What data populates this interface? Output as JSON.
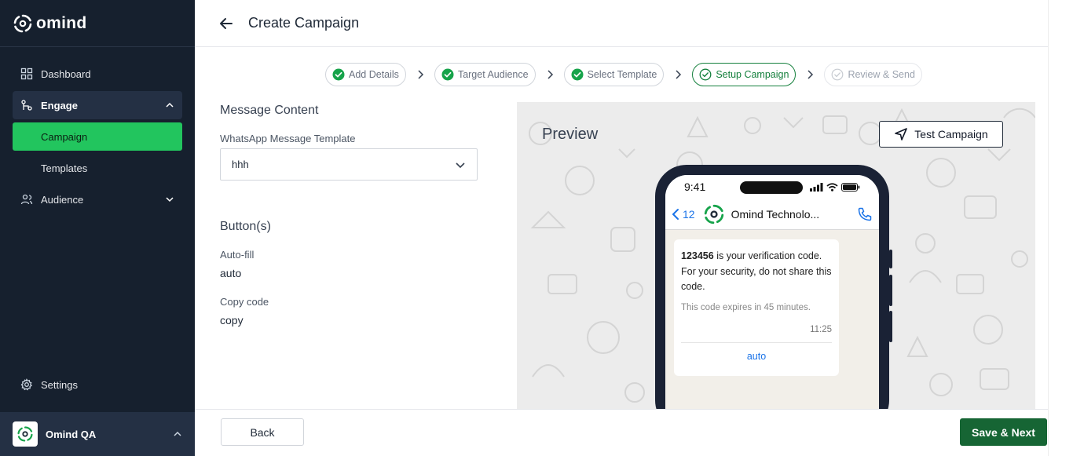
{
  "brand": {
    "name": "omind"
  },
  "sidebar": {
    "items": [
      {
        "label": "Dashboard",
        "icon": "grid-icon"
      },
      {
        "label": "Engage",
        "icon": "engage-icon",
        "expanded": true,
        "children": [
          {
            "label": "Campaign",
            "active": true
          },
          {
            "label": "Templates"
          }
        ]
      },
      {
        "label": "Audience",
        "icon": "users-icon",
        "expanded": false
      }
    ],
    "settings_label": "Settings",
    "user": {
      "name": "Omind QA"
    }
  },
  "header": {
    "title": "Create Campaign"
  },
  "stepper": {
    "steps": [
      {
        "label": "Add Details",
        "state": "done"
      },
      {
        "label": "Target Audience",
        "state": "done"
      },
      {
        "label": "Select Template",
        "state": "done"
      },
      {
        "label": "Setup Campaign",
        "state": "current"
      },
      {
        "label": "Review & Send",
        "state": "todo"
      }
    ]
  },
  "form": {
    "message_content_title": "Message Content",
    "template_label": "WhatsApp Message Template",
    "template_value": "hhh",
    "buttons_title": "Button(s)",
    "buttons": [
      {
        "label": "Auto-fill",
        "value": "auto"
      },
      {
        "label": "Copy code",
        "value": "copy"
      }
    ]
  },
  "preview": {
    "title": "Preview",
    "test_button": "Test Campaign",
    "phone": {
      "time": "9:41",
      "back_count": "12",
      "contact_name": "Omind Technolo...",
      "message_code": "123456",
      "message_text": " is your verification code. For your security, do not share this code.",
      "footer": "This code expires in 45 minutes.",
      "timestamp": "11:25",
      "button_label": "auto"
    }
  },
  "footer": {
    "back_label": "Back",
    "next_label": "Save & Next"
  },
  "colors": {
    "sidebar_bg": "#16202e",
    "accent_green": "#22c55e",
    "primary_dark_green": "#166534",
    "link_blue": "#1a73e8"
  }
}
